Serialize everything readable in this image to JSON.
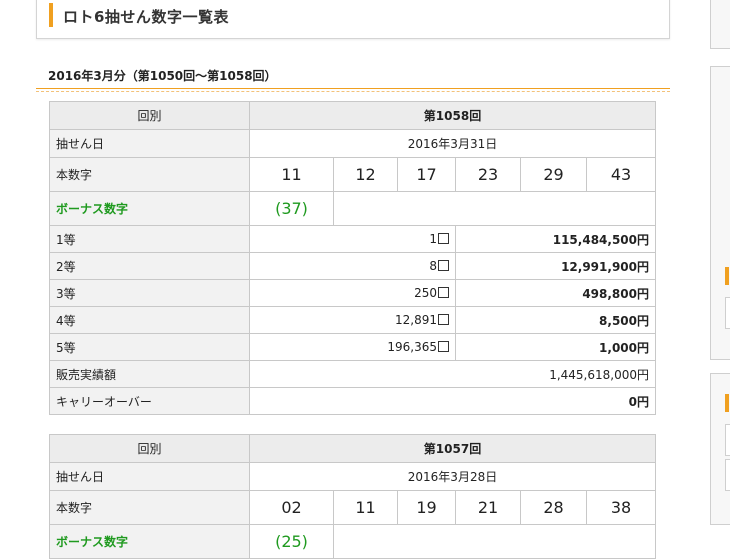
{
  "page": {
    "title": "ロト6抽せん数字一覧表",
    "section": "2016年3月分（第1050回〜第1058回）"
  },
  "labels": {
    "kaibetsu": "回別",
    "date": "抽せん日",
    "main_numbers": "本数字",
    "bonus": "ボーナス数字",
    "prize1": "1等",
    "prize2": "2等",
    "prize3": "3等",
    "prize4": "4等",
    "prize5": "5等",
    "sales": "販売実績額",
    "carryover": "キャリーオーバー"
  },
  "draws": [
    {
      "round": "第1058回",
      "date": "2016年3月31日",
      "numbers": [
        "11",
        "12",
        "17",
        "23",
        "29",
        "43"
      ],
      "bonus": "(37)",
      "prizes": [
        {
          "winners": "1",
          "amount": "115,484,500円"
        },
        {
          "winners": "8",
          "amount": "12,991,900円"
        },
        {
          "winners": "250",
          "amount": "498,800円"
        },
        {
          "winners": "12,891",
          "amount": "8,500円"
        },
        {
          "winners": "196,365",
          "amount": "1,000円"
        }
      ],
      "sales": "1,445,618,000円",
      "carryover": "0円"
    },
    {
      "round": "第1057回",
      "date": "2016年3月28日",
      "numbers": [
        "02",
        "11",
        "19",
        "21",
        "28",
        "38"
      ],
      "bonus": "(25)"
    }
  ]
}
